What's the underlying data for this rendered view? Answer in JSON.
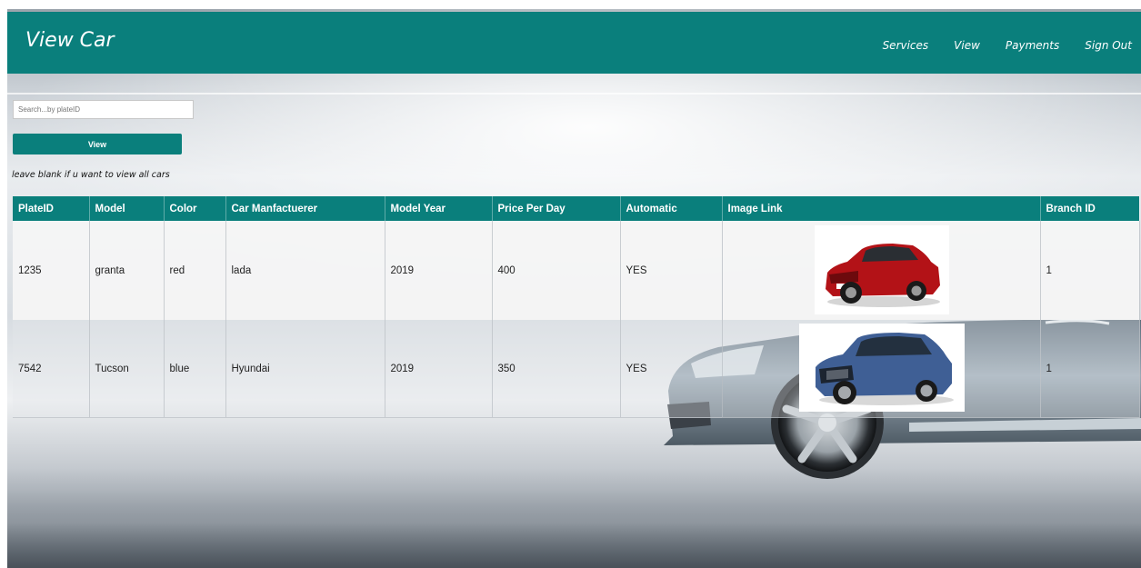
{
  "header": {
    "title": "View Car"
  },
  "nav": {
    "items": [
      "Services",
      "View",
      "Payments",
      "Sign Out"
    ]
  },
  "search": {
    "placeholder": "Search...by plateID",
    "button_label": "View"
  },
  "hint": "leave blank if u want to view all cars",
  "table": {
    "headers": [
      "PlateID",
      "Model",
      "Color",
      "Car Manfactuerer",
      "Model Year",
      "Price Per Day",
      "Automatic",
      "Image Link",
      "Branch ID"
    ],
    "rows": [
      {
        "plate_id": "1235",
        "model": "granta",
        "color": "red",
        "manufacturer": "lada",
        "model_year": "2019",
        "price_per_day": "400",
        "automatic": "YES",
        "image": "red-lada-granta-photo",
        "branch_id": "1"
      },
      {
        "plate_id": "7542",
        "model": "Tucson",
        "color": "blue",
        "manufacturer": "Hyundai",
        "model_year": "2019",
        "price_per_day": "350",
        "automatic": "YES",
        "image": "blue-hyundai-tucson-photo",
        "branch_id": "1"
      }
    ]
  },
  "colors": {
    "accent": "#0a7f7c",
    "header_text": "#ffffff"
  }
}
